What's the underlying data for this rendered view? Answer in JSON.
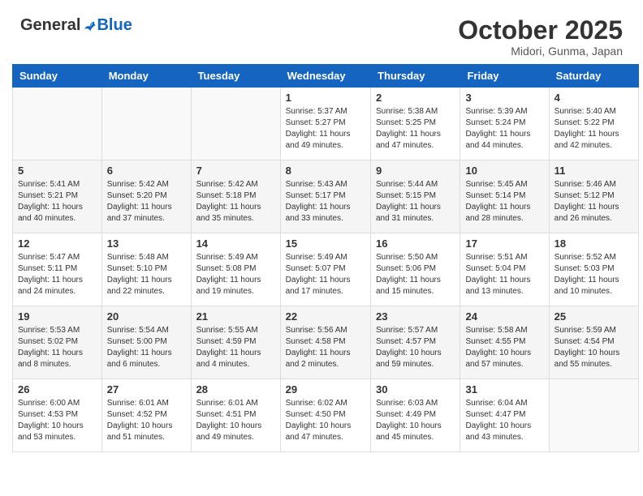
{
  "header": {
    "logo_general": "General",
    "logo_blue": "Blue",
    "month_title": "October 2025",
    "location": "Midori, Gunma, Japan"
  },
  "calendar": {
    "days_of_week": [
      "Sunday",
      "Monday",
      "Tuesday",
      "Wednesday",
      "Thursday",
      "Friday",
      "Saturday"
    ],
    "weeks": [
      [
        {
          "day": "",
          "info": ""
        },
        {
          "day": "",
          "info": ""
        },
        {
          "day": "",
          "info": ""
        },
        {
          "day": "1",
          "info": "Sunrise: 5:37 AM\nSunset: 5:27 PM\nDaylight: 11 hours\nand 49 minutes."
        },
        {
          "day": "2",
          "info": "Sunrise: 5:38 AM\nSunset: 5:25 PM\nDaylight: 11 hours\nand 47 minutes."
        },
        {
          "day": "3",
          "info": "Sunrise: 5:39 AM\nSunset: 5:24 PM\nDaylight: 11 hours\nand 44 minutes."
        },
        {
          "day": "4",
          "info": "Sunrise: 5:40 AM\nSunset: 5:22 PM\nDaylight: 11 hours\nand 42 minutes."
        }
      ],
      [
        {
          "day": "5",
          "info": "Sunrise: 5:41 AM\nSunset: 5:21 PM\nDaylight: 11 hours\nand 40 minutes."
        },
        {
          "day": "6",
          "info": "Sunrise: 5:42 AM\nSunset: 5:20 PM\nDaylight: 11 hours\nand 37 minutes."
        },
        {
          "day": "7",
          "info": "Sunrise: 5:42 AM\nSunset: 5:18 PM\nDaylight: 11 hours\nand 35 minutes."
        },
        {
          "day": "8",
          "info": "Sunrise: 5:43 AM\nSunset: 5:17 PM\nDaylight: 11 hours\nand 33 minutes."
        },
        {
          "day": "9",
          "info": "Sunrise: 5:44 AM\nSunset: 5:15 PM\nDaylight: 11 hours\nand 31 minutes."
        },
        {
          "day": "10",
          "info": "Sunrise: 5:45 AM\nSunset: 5:14 PM\nDaylight: 11 hours\nand 28 minutes."
        },
        {
          "day": "11",
          "info": "Sunrise: 5:46 AM\nSunset: 5:12 PM\nDaylight: 11 hours\nand 26 minutes."
        }
      ],
      [
        {
          "day": "12",
          "info": "Sunrise: 5:47 AM\nSunset: 5:11 PM\nDaylight: 11 hours\nand 24 minutes."
        },
        {
          "day": "13",
          "info": "Sunrise: 5:48 AM\nSunset: 5:10 PM\nDaylight: 11 hours\nand 22 minutes."
        },
        {
          "day": "14",
          "info": "Sunrise: 5:49 AM\nSunset: 5:08 PM\nDaylight: 11 hours\nand 19 minutes."
        },
        {
          "day": "15",
          "info": "Sunrise: 5:49 AM\nSunset: 5:07 PM\nDaylight: 11 hours\nand 17 minutes."
        },
        {
          "day": "16",
          "info": "Sunrise: 5:50 AM\nSunset: 5:06 PM\nDaylight: 11 hours\nand 15 minutes."
        },
        {
          "day": "17",
          "info": "Sunrise: 5:51 AM\nSunset: 5:04 PM\nDaylight: 11 hours\nand 13 minutes."
        },
        {
          "day": "18",
          "info": "Sunrise: 5:52 AM\nSunset: 5:03 PM\nDaylight: 11 hours\nand 10 minutes."
        }
      ],
      [
        {
          "day": "19",
          "info": "Sunrise: 5:53 AM\nSunset: 5:02 PM\nDaylight: 11 hours\nand 8 minutes."
        },
        {
          "day": "20",
          "info": "Sunrise: 5:54 AM\nSunset: 5:00 PM\nDaylight: 11 hours\nand 6 minutes."
        },
        {
          "day": "21",
          "info": "Sunrise: 5:55 AM\nSunset: 4:59 PM\nDaylight: 11 hours\nand 4 minutes."
        },
        {
          "day": "22",
          "info": "Sunrise: 5:56 AM\nSunset: 4:58 PM\nDaylight: 11 hours\nand 2 minutes."
        },
        {
          "day": "23",
          "info": "Sunrise: 5:57 AM\nSunset: 4:57 PM\nDaylight: 10 hours\nand 59 minutes."
        },
        {
          "day": "24",
          "info": "Sunrise: 5:58 AM\nSunset: 4:55 PM\nDaylight: 10 hours\nand 57 minutes."
        },
        {
          "day": "25",
          "info": "Sunrise: 5:59 AM\nSunset: 4:54 PM\nDaylight: 10 hours\nand 55 minutes."
        }
      ],
      [
        {
          "day": "26",
          "info": "Sunrise: 6:00 AM\nSunset: 4:53 PM\nDaylight: 10 hours\nand 53 minutes."
        },
        {
          "day": "27",
          "info": "Sunrise: 6:01 AM\nSunset: 4:52 PM\nDaylight: 10 hours\nand 51 minutes."
        },
        {
          "day": "28",
          "info": "Sunrise: 6:01 AM\nSunset: 4:51 PM\nDaylight: 10 hours\nand 49 minutes."
        },
        {
          "day": "29",
          "info": "Sunrise: 6:02 AM\nSunset: 4:50 PM\nDaylight: 10 hours\nand 47 minutes."
        },
        {
          "day": "30",
          "info": "Sunrise: 6:03 AM\nSunset: 4:49 PM\nDaylight: 10 hours\nand 45 minutes."
        },
        {
          "day": "31",
          "info": "Sunrise: 6:04 AM\nSunset: 4:47 PM\nDaylight: 10 hours\nand 43 minutes."
        },
        {
          "day": "",
          "info": ""
        }
      ]
    ]
  }
}
